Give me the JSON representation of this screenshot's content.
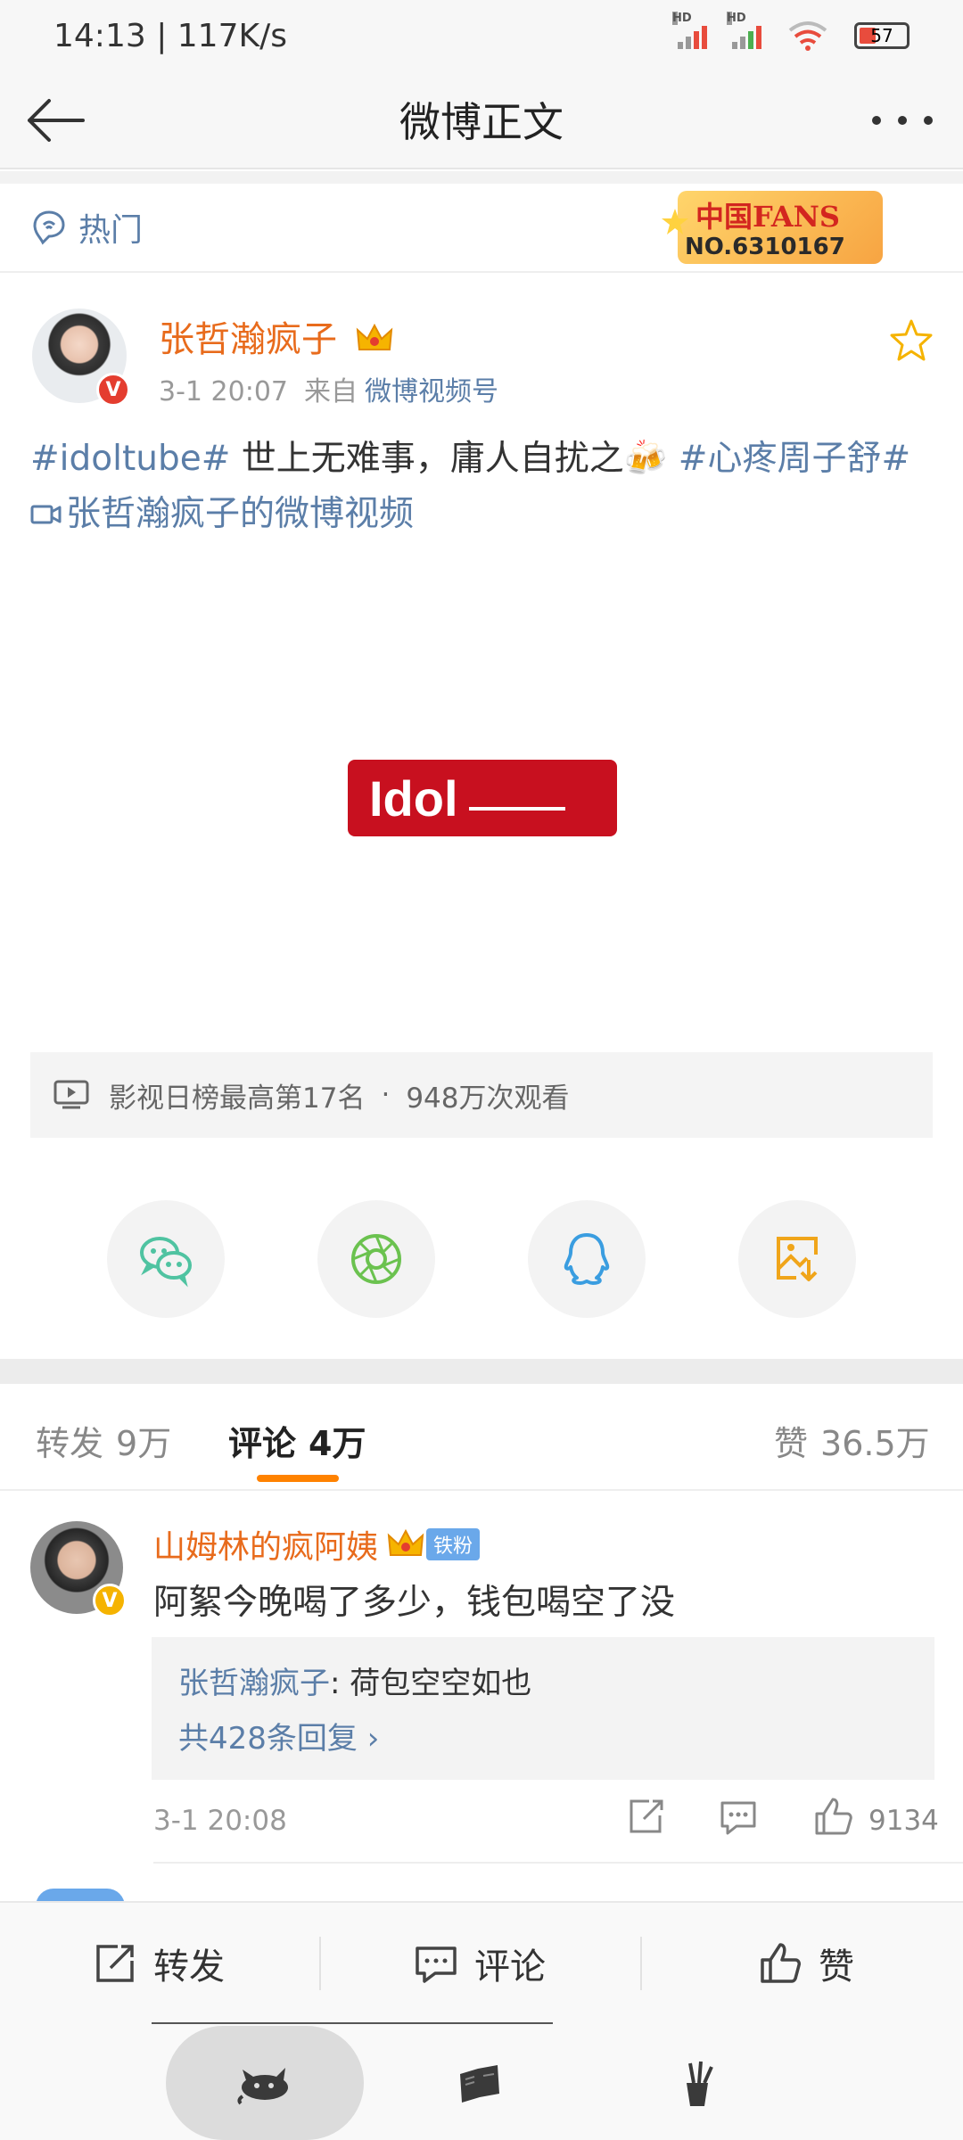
{
  "status_bar": {
    "time_speed": "14:13 | 117K/s",
    "battery": "57"
  },
  "nav": {
    "title": "微博正文"
  },
  "hot": {
    "label": "热门",
    "fans_badge_title": "中国FANS",
    "fans_badge_no": "NO.6310167"
  },
  "post": {
    "author": "张哲瀚疯子",
    "time": "3-1 20:07",
    "from_label": "来自",
    "source": "微博视频号",
    "tag1": "#idoltube#",
    "text": " 世上无难事，庸人自扰之🍻 ",
    "tag2": "#心疼周子舒#",
    "video_link": "张哲瀚疯子的微博视频",
    "video_logo": "Idol",
    "video_rank": "影视日榜最高第17名",
    "video_dot": "·",
    "video_views": "948万次观看"
  },
  "tabs": {
    "repost_label": "转发",
    "repost_count": "9万",
    "comment_label": "评论",
    "comment_count": "4万",
    "like_label": "赞",
    "like_count": "36.5万"
  },
  "comment": {
    "user": "山姆林的疯阿姨",
    "badge": "铁粉",
    "text": "阿絮今晚喝了多少，钱包喝空了没",
    "reply_author": "张哲瀚疯子",
    "reply_text": ": 荷包空空如也",
    "reply_count": "共428条回复 ›",
    "time": "3-1 20:08",
    "likes": "9134"
  },
  "action_bar": {
    "repost": "转发",
    "comment": "评论",
    "like": "赞"
  },
  "colors": {
    "link": "#5b7ea8",
    "username": "#e86b1c",
    "accent": "#ff8200"
  }
}
